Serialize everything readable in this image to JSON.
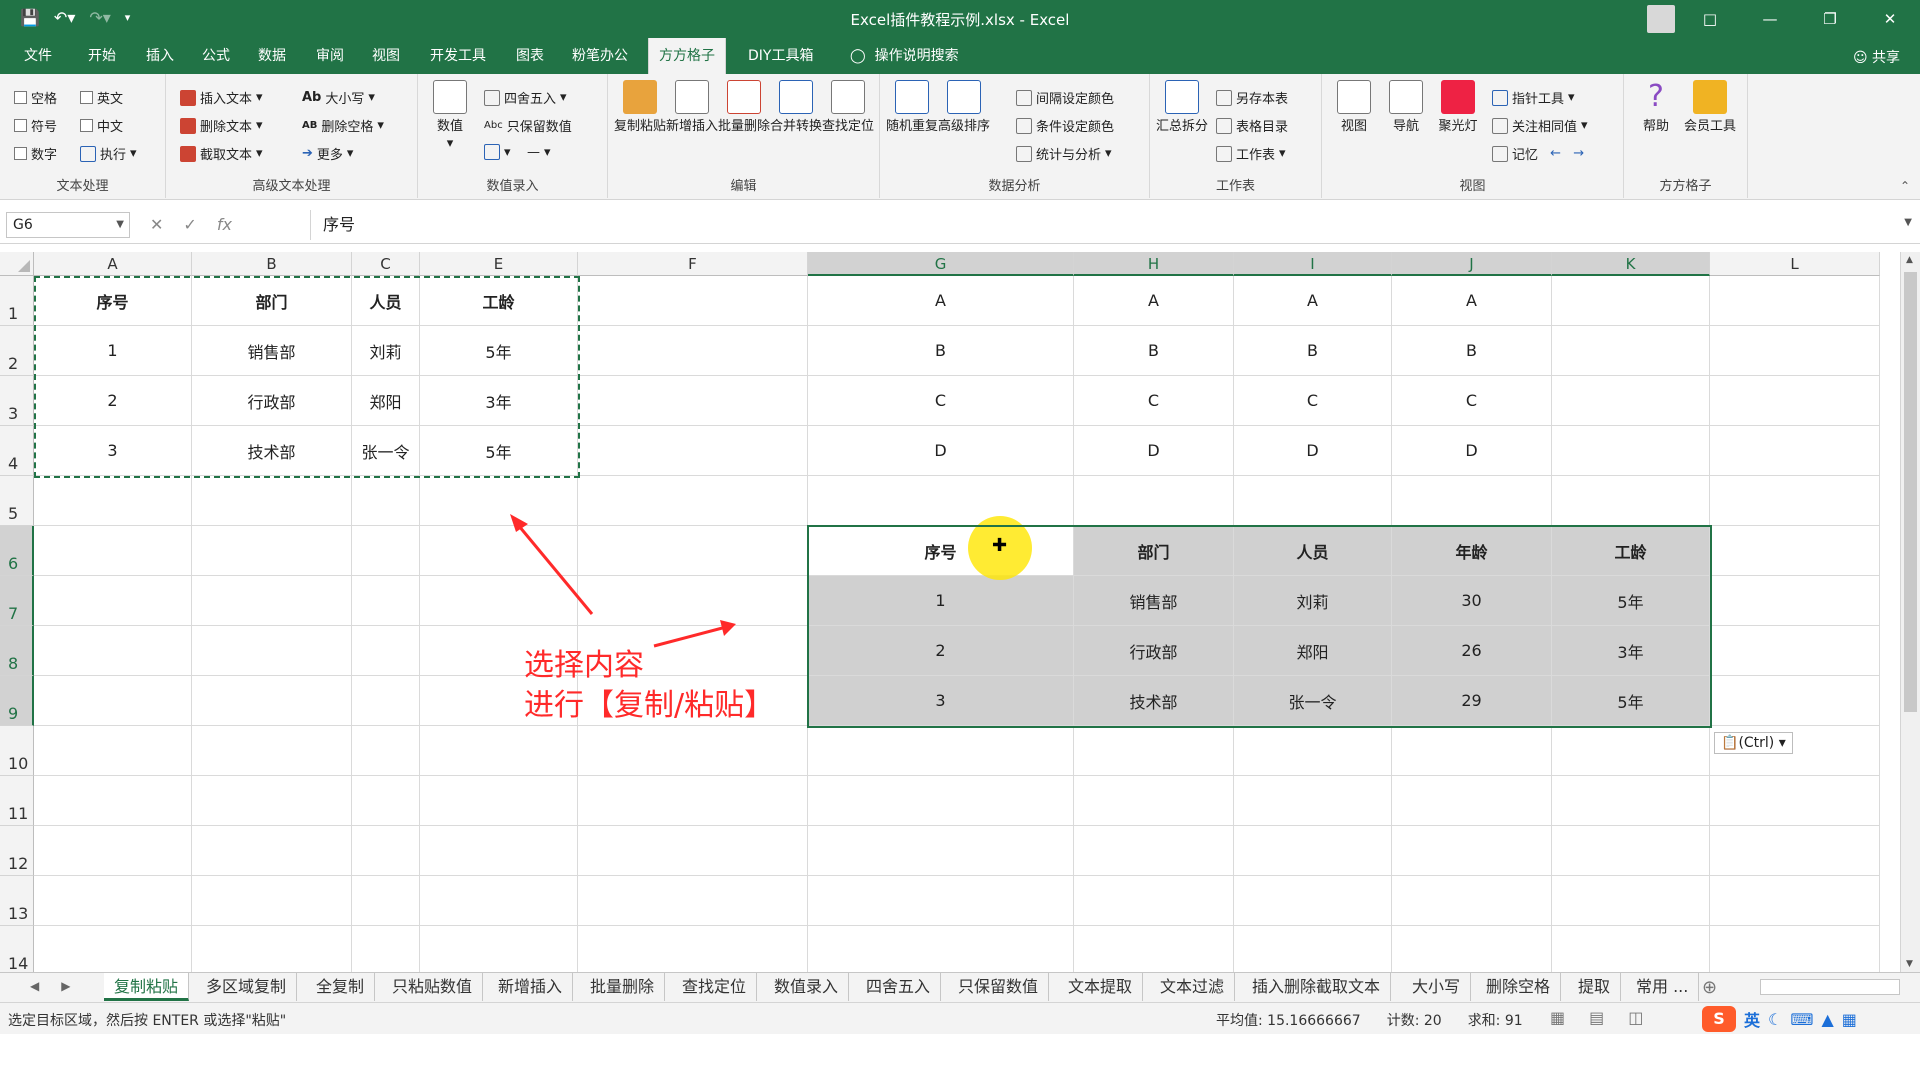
{
  "window": {
    "title": "Excel插件教程示例.xlsx  -  Excel",
    "share": "共享"
  },
  "tabs": [
    "文件",
    "开始",
    "插入",
    "公式",
    "数据",
    "审阅",
    "视图",
    "开发工具",
    "图表",
    "粉笔办公",
    "方方格子",
    "DIY工具箱",
    "操作说明搜索"
  ],
  "active_tab": "方方格子",
  "ribbon": {
    "text_group": {
      "label": "文本处理",
      "items": [
        "空格",
        "英文",
        "符号",
        "中文",
        "数字",
        "执行"
      ]
    },
    "adv_text_group": {
      "label": "高级文本处理",
      "items": [
        "插入文本",
        "删除文本",
        "截取文本",
        "大小写",
        "删除空格",
        "更多"
      ]
    },
    "input_group": {
      "label": "数值录入",
      "big": "数值",
      "items": [
        "四舍五入",
        "只保留数值"
      ]
    },
    "edit_group": {
      "label": "编辑",
      "buttons": [
        "复制粘贴",
        "新增插入",
        "批量删除",
        "合并转换",
        "查找定位"
      ]
    },
    "analysis_group": {
      "label": "数据分析",
      "buttons": [
        "随机重复",
        "高级排序"
      ],
      "items": [
        "间隔设定颜色",
        "条件设定颜色",
        "统计与分析"
      ]
    },
    "sheet_group": {
      "label": "工作表",
      "big": "汇总拆分",
      "items": [
        "另存本表",
        "表格目录",
        "工作表"
      ]
    },
    "view_group": {
      "label": "视图",
      "buttons": [
        "视图",
        "导航",
        "聚光灯"
      ],
      "items": [
        "指针工具",
        "关注相同值",
        "记忆"
      ]
    },
    "ffgz_group": {
      "label": "方方格子",
      "buttons": [
        "帮助",
        "会员工具"
      ]
    }
  },
  "formula_bar": {
    "name_box": "G6",
    "formula": "序号"
  },
  "grid": {
    "columns": [
      "A",
      "B",
      "C",
      "E",
      "F",
      "G",
      "H",
      "I",
      "J",
      "K",
      "L"
    ],
    "rows": [
      "1",
      "2",
      "3",
      "4",
      "5",
      "6",
      "7",
      "8",
      "9",
      "10",
      "11",
      "12",
      "13",
      "14"
    ],
    "left_table": {
      "headers": [
        "序号",
        "部门",
        "人员",
        "工龄"
      ],
      "rows": [
        [
          "1",
          "销售部",
          "刘莉",
          "5年"
        ],
        [
          "2",
          "行政部",
          "郑阳",
          "3年"
        ],
        [
          "3",
          "技术部",
          "张一令",
          "5年"
        ]
      ]
    },
    "letters": [
      "A",
      "B",
      "C",
      "D"
    ],
    "right_table": {
      "headers": [
        "序号",
        "部门",
        "人员",
        "年龄",
        "工龄"
      ],
      "rows": [
        [
          "1",
          "销售部",
          "刘莉",
          "30",
          "5年"
        ],
        [
          "2",
          "行政部",
          "郑阳",
          "26",
          "3年"
        ],
        [
          "3",
          "技术部",
          "张一令",
          "29",
          "5年"
        ]
      ]
    },
    "paste_options": "(Ctrl)"
  },
  "annotation": {
    "line1": "选择内容",
    "line2": "进行【复制/粘贴】",
    "color": "#ff2a2a"
  },
  "sheet_tabs": [
    "复制粘贴",
    "多区域复制",
    "全复制",
    "只粘贴数值",
    "新增插入",
    "批量删除",
    "查找定位",
    "数值录入",
    "四舍五入",
    "只保留数值",
    "文本提取",
    "文本过滤",
    "插入删除截取文本",
    "大小写",
    "删除空格",
    "提取",
    "常用 ..."
  ],
  "active_sheet": "复制粘贴",
  "status": {
    "message": "选定目标区域，然后按 ENTER 或选择\"粘贴\"",
    "average": "平均值: 15.16666667",
    "count": "计数: 20",
    "sum": "求和: 91",
    "ime_lang": "英"
  },
  "colors": {
    "excel_green": "#217346",
    "selection_fill": "#d0d0d0",
    "highlight": "#ffe600"
  }
}
